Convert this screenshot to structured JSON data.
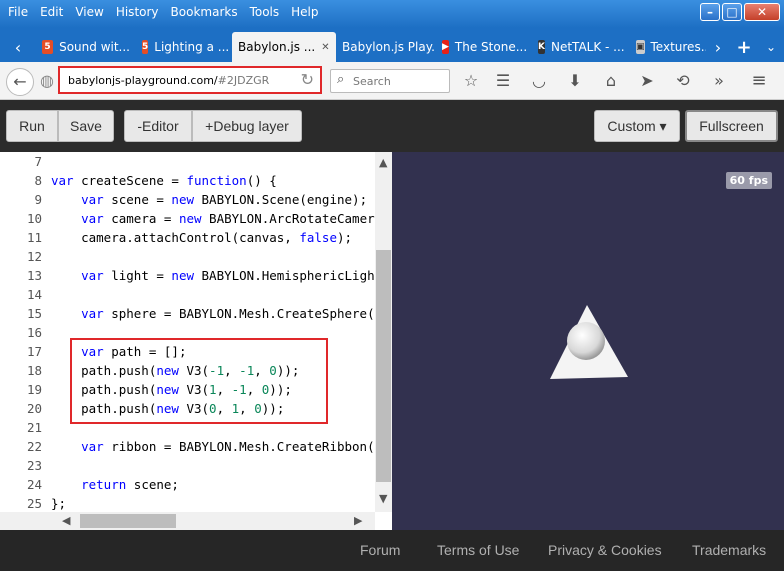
{
  "menu": [
    "File",
    "Edit",
    "View",
    "History",
    "Bookmarks",
    "Tools",
    "Help"
  ],
  "window_controls": {
    "minimize": "–",
    "maximize": "□",
    "close": "✕"
  },
  "tabs": [
    {
      "label": "Sound wit...",
      "icon": "html5-icon"
    },
    {
      "label": "Lighting a ...",
      "icon": "html5-icon"
    },
    {
      "label": "Babylon.js ...",
      "icon": "",
      "active": true
    },
    {
      "label": "Babylon.js Play...",
      "icon": ""
    },
    {
      "label": "The Stone...",
      "icon": "youtube-icon"
    },
    {
      "label": "NetTALK - ...",
      "icon": "k-icon"
    },
    {
      "label": "Textures...",
      "icon": "cube-icon"
    }
  ],
  "tab_new": "+",
  "tab_more": "›",
  "tab_left": "‹",
  "tab_overflow": "⌄",
  "tab_close": "✕",
  "url": {
    "host": "babylonjs-playground.com/",
    "hash": "#2JDZGR"
  },
  "search": {
    "placeholder": "Search"
  },
  "app_toolbar": {
    "run": "Run",
    "save": "Save",
    "editor": "-Editor",
    "debug": "+Debug layer",
    "custom": "Custom ▾",
    "fullscreen": "Fullscreen"
  },
  "code_lines": [
    {
      "n": "7",
      "html": ""
    },
    {
      "n": "8",
      "html": "<span class=\"kw\">var</span> createScene = <span class=\"kw\">function</span>() {"
    },
    {
      "n": "9",
      "html": "    <span class=\"kw\">var</span> scene = <span class=\"kw\">new</span> BABYLON.Scene(engine);"
    },
    {
      "n": "10",
      "html": "    <span class=\"kw\">var</span> camera = <span class=\"kw\">new</span> BABYLON.ArcRotateCamera"
    },
    {
      "n": "11",
      "html": "    camera.attachControl(canvas, <span class=\"kw\">false</span>);"
    },
    {
      "n": "12",
      "html": ""
    },
    {
      "n": "13",
      "html": "    <span class=\"kw\">var</span> light = <span class=\"kw\">new</span> BABYLON.HemisphericLight"
    },
    {
      "n": "14",
      "html": ""
    },
    {
      "n": "15",
      "html": "    <span class=\"kw\">var</span> sphere = BABYLON.Mesh.CreateSphere("
    },
    {
      "n": "16",
      "html": ""
    },
    {
      "n": "17",
      "html": "    <span class=\"kw\">var</span> path = [];"
    },
    {
      "n": "18",
      "html": "    path.push(<span class=\"kw\">new</span> V3(<span class=\"num\">-1</span>, <span class=\"num\">-1</span>, <span class=\"num\">0</span>));"
    },
    {
      "n": "19",
      "html": "    path.push(<span class=\"kw\">new</span> V3(<span class=\"num\">1</span>, <span class=\"num\">-1</span>, <span class=\"num\">0</span>));"
    },
    {
      "n": "20",
      "html": "    path.push(<span class=\"kw\">new</span> V3(<span class=\"num\">0</span>, <span class=\"num\">1</span>, <span class=\"num\">0</span>));"
    },
    {
      "n": "21",
      "html": ""
    },
    {
      "n": "22",
      "html": "    <span class=\"kw\">var</span> ribbon = BABYLON.Mesh.CreateRibbon("
    },
    {
      "n": "23",
      "html": ""
    },
    {
      "n": "24",
      "html": "    <span class=\"kw\">return</span> scene;"
    },
    {
      "n": "25",
      "html": "};"
    }
  ],
  "fps": "60 fps",
  "footer": [
    "Forum",
    "Terms of Use",
    "Privacy & Cookies",
    "Trademarks"
  ],
  "colors": {
    "scene_bg": "#32314f",
    "highlight": "#e0282a",
    "keyword": "#0000ff",
    "number": "#098658"
  }
}
